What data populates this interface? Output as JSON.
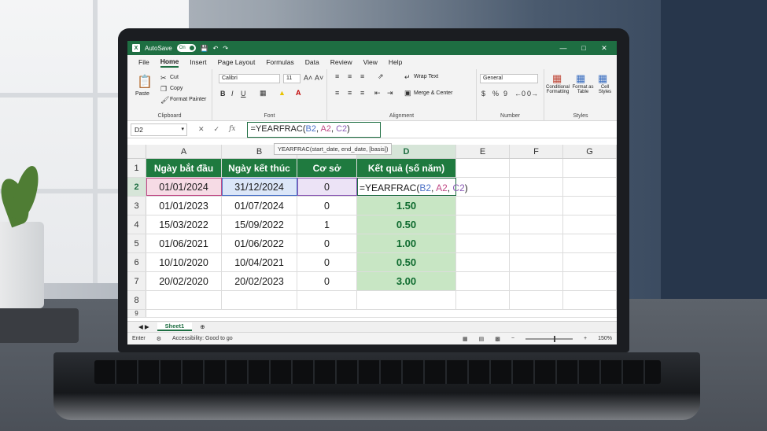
{
  "titlebar": {
    "autosave_label": "AutoSave",
    "autosave_state": "On"
  },
  "menu": [
    "File",
    "Home",
    "Insert",
    "Page Layout",
    "Formulas",
    "Data",
    "Review",
    "View",
    "Help"
  ],
  "menu_active": "Home",
  "ribbon": {
    "clipboard": {
      "label": "Clipboard",
      "paste": "Paste",
      "cut": "Cut",
      "copy": "Copy",
      "format_painter": "Format Painter"
    },
    "font": {
      "label": "Font",
      "family": "Calibri",
      "size": "11"
    },
    "alignment": {
      "label": "Alignment",
      "wrap": "Wrap Text",
      "merge": "Merge & Center"
    },
    "number": {
      "label": "Number",
      "format": "General"
    },
    "styles": {
      "label": "Styles",
      "conditional": "Conditional Formatting",
      "format_table": "Format as Table",
      "cell_styles": "Cell Styles"
    }
  },
  "formula_bar": {
    "name_box": "D2",
    "formula_prefix": "=YEARFRAC(",
    "ref1": "B2",
    "sep1": ", ",
    "ref2": "A2",
    "sep2": ", ",
    "ref3": "C2",
    "formula_suffix": ")",
    "tooltip": "YEARFRAC(start_date, end_date, [basis])"
  },
  "columns": [
    "A",
    "B",
    "C",
    "D",
    "E",
    "F",
    "G"
  ],
  "rows": [
    "1",
    "2",
    "3",
    "4",
    "5",
    "6",
    "7",
    "8",
    "9"
  ],
  "table": {
    "headers": [
      "Ngày bắt đầu",
      "Ngày kết thúc",
      "Cơ sở",
      "Kết quả (số năm)"
    ],
    "data": [
      [
        "01/01/2024",
        "31/12/2024",
        "0",
        ""
      ],
      [
        "01/01/2023",
        "01/07/2024",
        "0",
        "1.50"
      ],
      [
        "15/03/2022",
        "15/09/2022",
        "1",
        "0.50"
      ],
      [
        "01/06/2021",
        "01/06/2022",
        "0",
        "1.00"
      ],
      [
        "10/10/2020",
        "10/04/2021",
        "0",
        "0.50"
      ],
      [
        "20/02/2020",
        "20/02/2023",
        "0",
        "3.00"
      ]
    ]
  },
  "sheet_tab": "Sheet1",
  "status": {
    "mode": "Enter",
    "accessibility": "Accessibility: Good to go",
    "zoom": "150%"
  },
  "colors": {
    "excel_green": "#1e6e42",
    "header_green": "#1f7a3f",
    "result_fill": "#c8e6c4"
  }
}
